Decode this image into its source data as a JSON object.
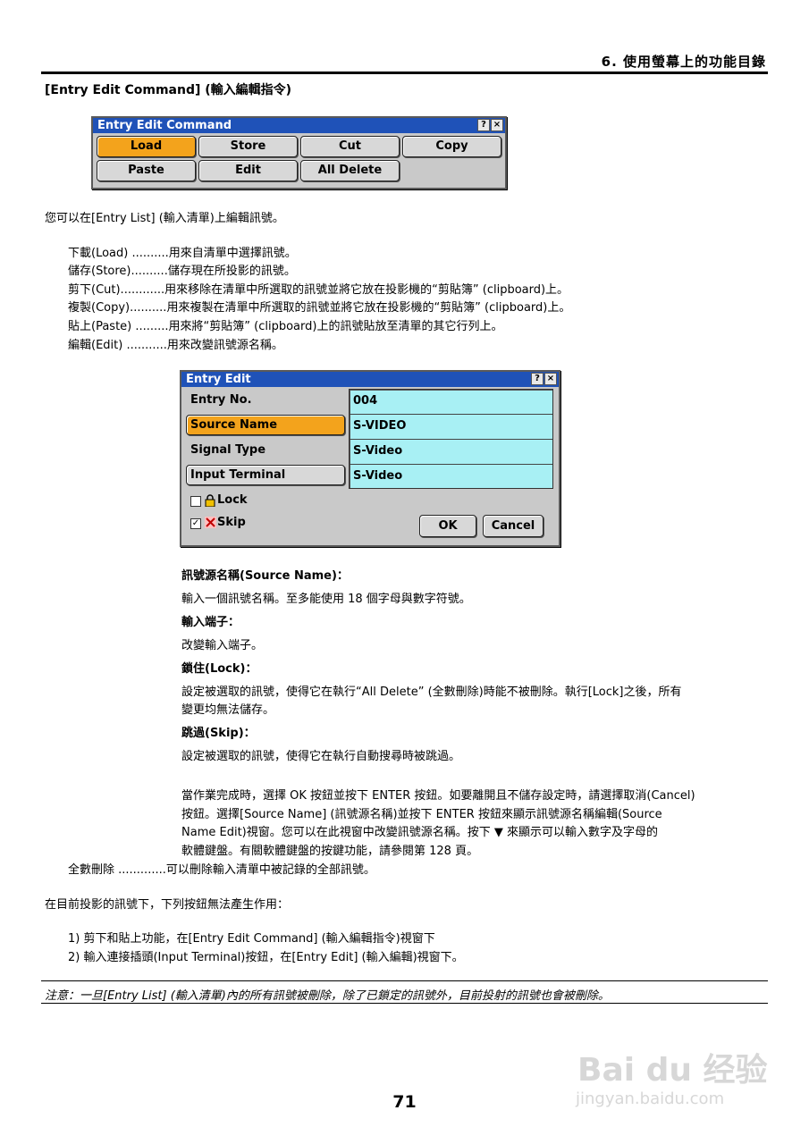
{
  "header": {
    "title": "6. 使用螢幕上的功能目錄"
  },
  "section": {
    "heading": "[Entry Edit Command] (輸入編輯指令)"
  },
  "cmd_window": {
    "title": "Entry Edit Command",
    "help": "?",
    "close": "×",
    "buttons": [
      "Load",
      "Store",
      "Cut",
      "Copy",
      "Paste",
      "Edit",
      "All Delete"
    ]
  },
  "intro": "您可以在[Entry List] (輸入清單)上編輯訊號。",
  "functions": [
    "下載(Load) ..........用來自清單中選擇訊號。",
    "儲存(Store)..........儲存現在所投影的訊號。",
    "剪下(Cut)............用來移除在清單中所選取的訊號並將它放在投影機的“剪貼簿” (clipboard)上。",
    "複製(Copy)..........用來複製在清單中所選取的訊號並將它放在投影機的“剪貼簿” (clipboard)上。",
    "貼上(Paste) .........用來將“剪貼簿” (clipboard)上的訊號貼放至清單的其它行列上。",
    "編輯(Edit) ...........用來改變訊號源名稱。"
  ],
  "edit_window": {
    "title": "Entry Edit",
    "help": "?",
    "close": "×",
    "labels": {
      "entry_no": "Entry No.",
      "source_name": "Source Name",
      "signal_type": "Signal Type",
      "input_terminal": "Input Terminal"
    },
    "values": {
      "entry_no": "004",
      "source_name": "S-VIDEO",
      "signal_type": "S-Video",
      "input_terminal": "S-Video"
    },
    "lock": {
      "label": "Lock",
      "checked": false,
      "mark": ""
    },
    "skip": {
      "label": "Skip",
      "checked": true,
      "mark": "✓"
    },
    "ok": "OK",
    "cancel": "Cancel"
  },
  "descriptions": {
    "source_name_h": "訊號源名稱(Source Name)：",
    "source_name_t": "輸入一個訊號名稱。至多能使用 18 個字母與數字符號。",
    "input_terminal_h": "輸入端子：",
    "input_terminal_t": "改變輸入端子。",
    "lock_h": "鎖住(Lock)：",
    "lock_t1": "設定被選取的訊號，使得它在執行“All Delete” (全數刪除)時能不被刪除。執行[Lock]之後，所有",
    "lock_t2": "變更均無法儲存。",
    "skip_h": "跳過(Skip)：",
    "skip_t": "設定被選取的訊號，使得它在執行自動搜尋時被跳過。"
  },
  "completion": [
    "當作業完成時，選擇 OK 按鈕並按下 ENTER 按鈕。如要離開且不儲存設定時，請選擇取消(Cancel)",
    "按鈕。選擇[Source Name] (訊號源名稱)並按下 ENTER 按鈕來顯示訊號源名稱編輯(Source",
    "Name Edit)視窗。您可以在此視窗中改變訊號源名稱。按下 ▼ 來顯示可以輸入數字及字母的",
    "軟體鍵盤。有關軟體鍵盤的按鍵功能，請參閱第 128 頁。"
  ],
  "all_delete": "全數刪除 .............可以刪除輸入清單中被記錄的全部訊號。",
  "limitation": {
    "intro": "在目前投影的訊號下，下列按鈕無法產生作用：",
    "items": [
      "1)  剪下和貼上功能，在[Entry Edit Command] (輸入編輯指令)視窗下",
      "2)  輸入連接插頭(Input Terminal)按鈕，在[Entry Edit] (輸入編輯)視窗下。"
    ]
  },
  "note": "注意：一旦[Entry List] (輸入清單)內的所有訊號被刪除，除了已鎖定的訊號外，目前投射的訊號也會被刪除。",
  "page_number": "71",
  "watermark": {
    "logo": "Bai du 经验",
    "url": "jingyan.baidu.com"
  }
}
